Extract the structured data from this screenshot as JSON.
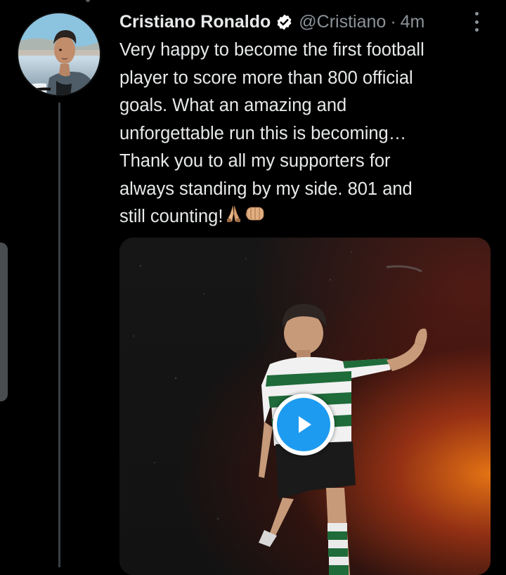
{
  "tweet": {
    "author_name": "Cristiano Ronaldo",
    "handle": "@Cristiano",
    "separator": "·",
    "time": "4m",
    "text": "Very happy to become the first football\nplayer to score more than 800 official\ngoals. What an amazing and\nunforgettable run this is becoming…\nThank you to all my supporters for\nalways standing by my side. 801 and\nstill counting!",
    "emojis": [
      "folded-hands-icon",
      "fist-bump-icon"
    ]
  },
  "colors": {
    "background": "#000000",
    "text": "#e7e9ea",
    "secondary_text": "#8b9298",
    "verified_badge": "#ffffff",
    "play_button": "#1d9bf0"
  }
}
